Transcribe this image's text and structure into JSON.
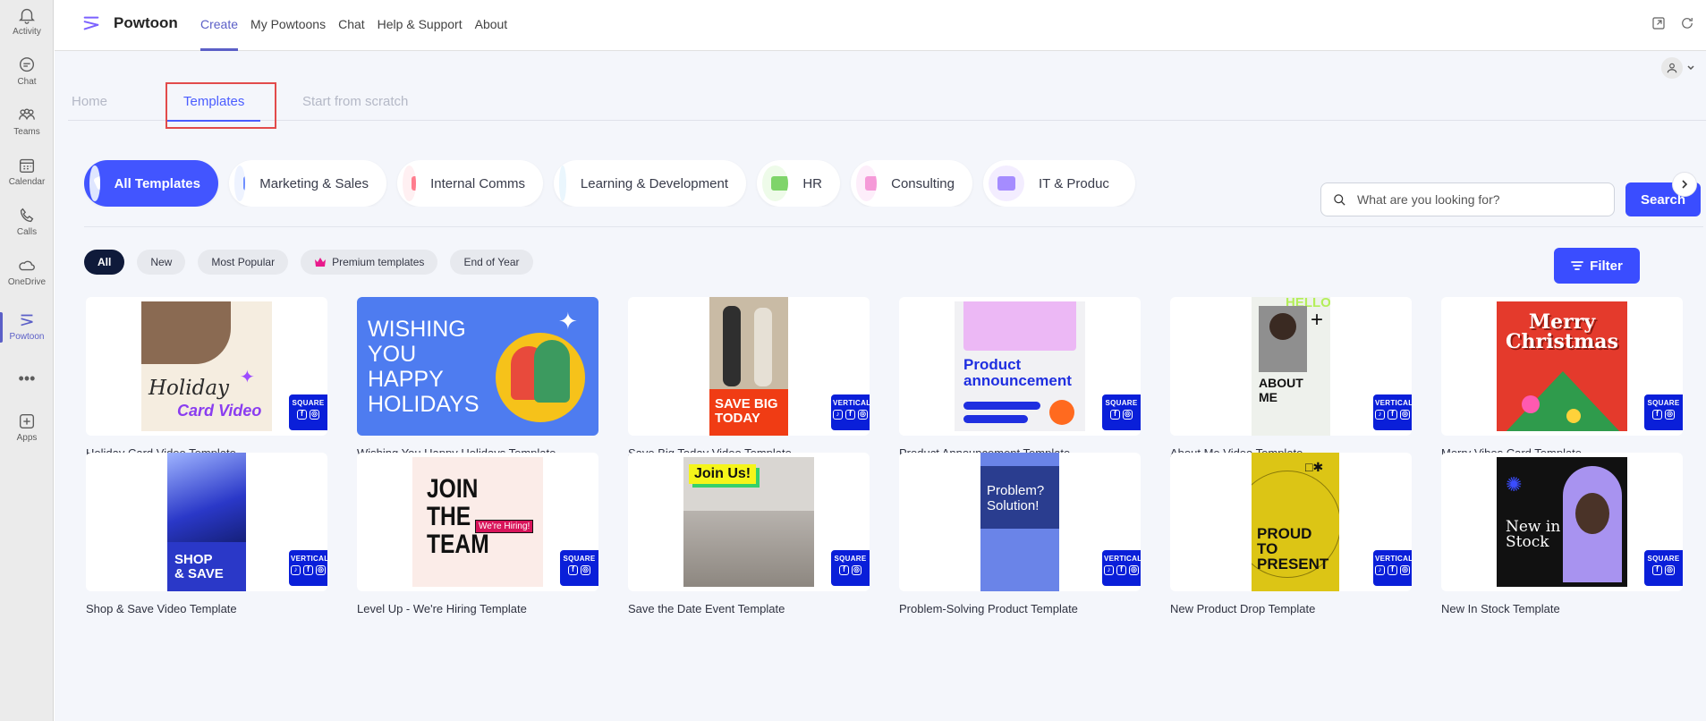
{
  "rail": [
    {
      "label": "Activity",
      "icon": "bell-icon"
    },
    {
      "label": "Chat",
      "icon": "chat-icon"
    },
    {
      "label": "Teams",
      "icon": "teams-icon"
    },
    {
      "label": "Calendar",
      "icon": "calendar-icon"
    },
    {
      "label": "Calls",
      "icon": "phone-icon"
    },
    {
      "label": "OneDrive",
      "icon": "cloud-icon"
    },
    {
      "label": "Powtoon",
      "icon": "powtoon-icon"
    },
    {
      "label": "Apps",
      "icon": "plus-square-icon"
    }
  ],
  "header": {
    "brand": "Powtoon",
    "nav": [
      "Create",
      "My Powtoons",
      "Chat",
      "Help & Support",
      "About"
    ]
  },
  "tabs": [
    "Home",
    "Templates",
    "Start from scratch"
  ],
  "search": {
    "placeholder": "What are you looking for?",
    "button": "Search"
  },
  "categories": [
    "All Templates",
    "Marketing & Sales",
    "Internal Comms",
    "Learning & Development",
    "HR",
    "Consulting",
    "IT & Produc"
  ],
  "chips": [
    "All",
    "New",
    "Most Popular",
    "Premium templates",
    "End of Year"
  ],
  "filter_label": "Filter",
  "templates": [
    {
      "title": "Holiday Card Video Template",
      "badge": "SQUARE",
      "art": [
        "Holiday",
        "Card Video"
      ]
    },
    {
      "title": "Wishing You Happy Holidays Template",
      "art": [
        "WISHING",
        "YOU",
        "HAPPY",
        "HOLIDAYS"
      ]
    },
    {
      "title": "Save Big Today Video Template",
      "badge": "VERTICAL",
      "art": [
        "SAVE BIG",
        "TODAY"
      ]
    },
    {
      "title": "Product Announcement Template",
      "badge": "SQUARE",
      "art": [
        "Product",
        "announcement"
      ]
    },
    {
      "title": "About Me Video Template",
      "badge": "VERTICAL",
      "art": [
        "ABOUT",
        "ME",
        "HELLO"
      ]
    },
    {
      "title": "Merry Vibes Card Template",
      "badge": "SQUARE",
      "art": [
        "Merry",
        "Christmas"
      ]
    },
    {
      "title": "Shop & Save Video Template",
      "badge": "VERTICAL",
      "art": [
        "SHOP",
        "& SAVE"
      ]
    },
    {
      "title": "Level Up - We're Hiring Template",
      "badge": "SQUARE",
      "art": [
        "JOIN",
        "THE",
        "TEAM",
        "We're Hiring!"
      ]
    },
    {
      "title": "Save the Date Event Template",
      "badge": "SQUARE",
      "art": [
        "Join Us!"
      ]
    },
    {
      "title": "Problem-Solving Product Template",
      "badge": "VERTICAL",
      "art": [
        "Problem?",
        "Solution!"
      ]
    },
    {
      "title": "New Product Drop Template",
      "badge": "VERTICAL",
      "art": [
        "PROUD",
        "TO",
        "PRESENT"
      ]
    },
    {
      "title": "New In Stock Template",
      "badge": "SQUARE",
      "art": [
        "New in",
        "Stock"
      ]
    }
  ],
  "colors": {
    "accent": "#3a4dff",
    "teams": "#5b5fc7",
    "highlight": "#e24b4b"
  }
}
